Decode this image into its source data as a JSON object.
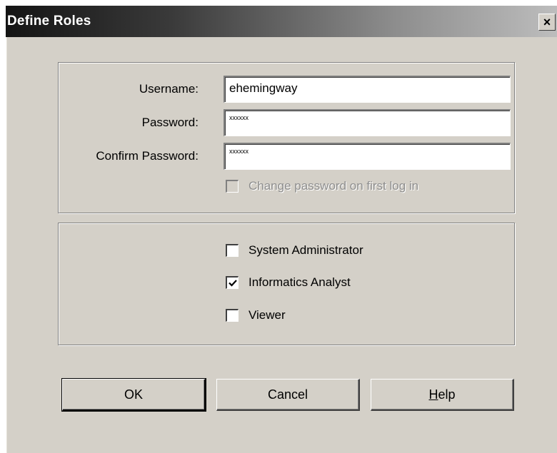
{
  "window": {
    "title": "Define Roles",
    "close_label": "×"
  },
  "credentials": {
    "username_label": "Username:",
    "username_value": "ehemingway",
    "password_label": "Password:",
    "password_value": "xxxxxx",
    "confirm_label": "Confirm Password:",
    "confirm_value": "xxxxxx",
    "change_password": {
      "label": "Change password on first log in",
      "checked": false,
      "enabled": false
    }
  },
  "roles": [
    {
      "label": "System Administrator",
      "checked": false
    },
    {
      "label": "Informatics Analyst",
      "checked": true
    },
    {
      "label": "Viewer",
      "checked": false
    }
  ],
  "buttons": {
    "ok": "OK",
    "cancel": "Cancel",
    "help_first": "H",
    "help_rest": "elp"
  },
  "colors": {
    "face": "#d4d0c8",
    "title_start": "#141414",
    "title_end": "#bdbdbd"
  }
}
